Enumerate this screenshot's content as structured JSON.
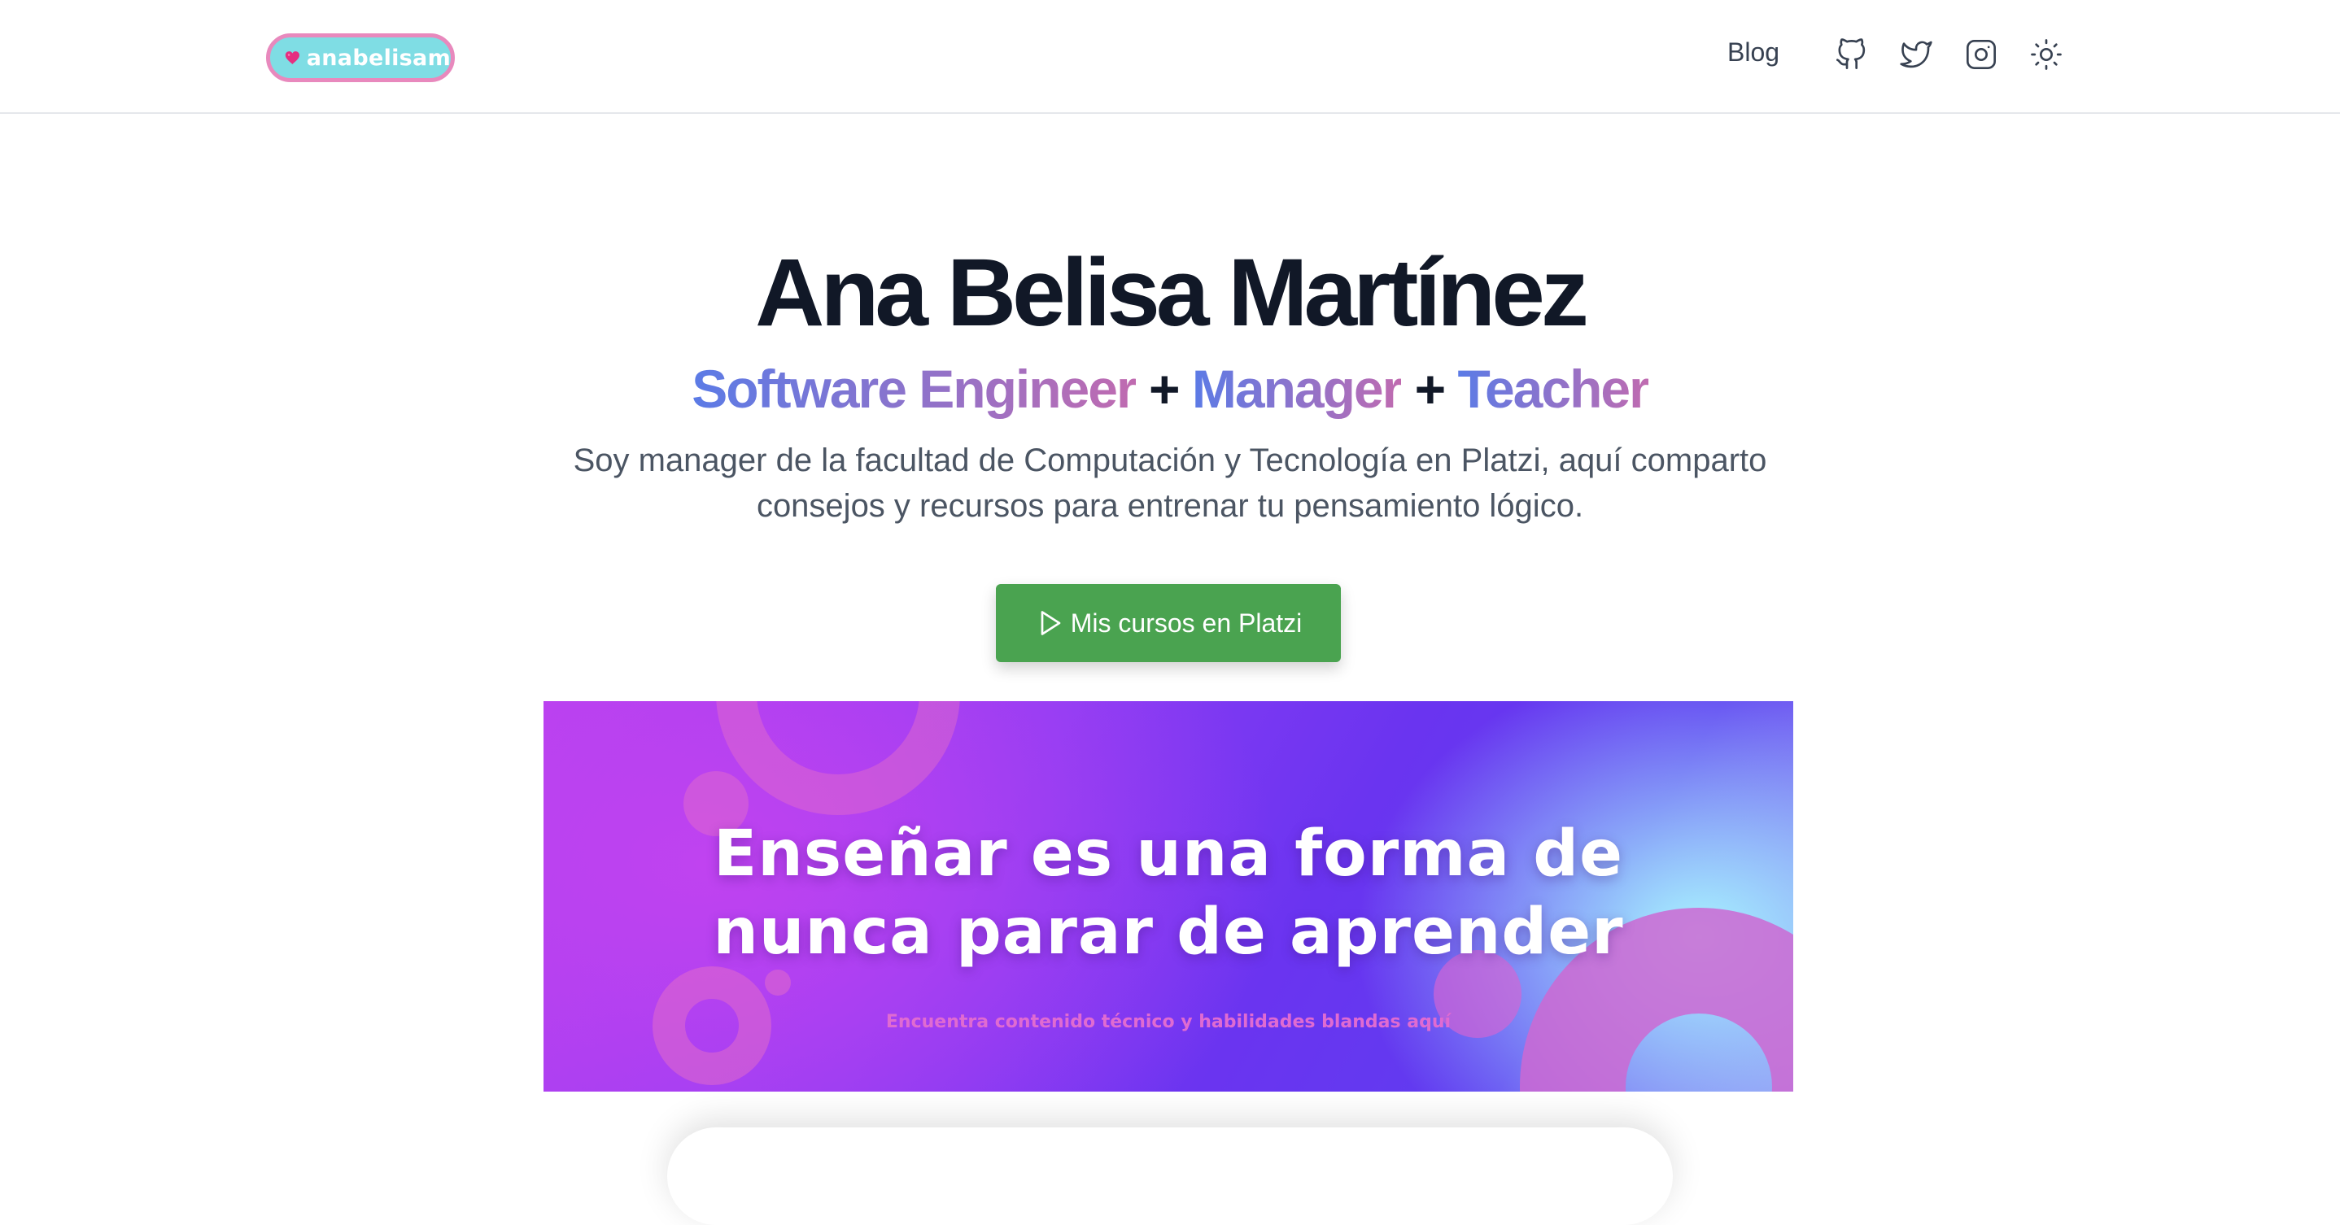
{
  "header": {
    "logo_text": "anabelisam",
    "nav_blog": "Blog",
    "icons": [
      "github-icon",
      "twitter-icon",
      "instagram-icon",
      "sun-icon"
    ]
  },
  "hero": {
    "name": "Ana Belisa Martínez",
    "roles": [
      "Software Engineer",
      "Manager",
      "Teacher"
    ],
    "plus": "+",
    "description_line1": "Soy manager de la facultad de Computación y Tecnología en Platzi, aquí comparto",
    "description_line2": "consejos y recursos para entrenar tu pensamiento lógico.",
    "cta_label": "Mis cursos en Platzi"
  },
  "banner": {
    "headline_line1": "Enseñar es una forma de",
    "headline_line2": "nunca parar de aprender",
    "subtext": "Encuentra contenido técnico y habilidades blandas aquí"
  },
  "colors": {
    "text_dark": "#111827",
    "text_muted": "#4b5563",
    "cta_green": "#4aa350",
    "gradient_start": "#5b7be6",
    "gradient_end": "#c06bb0",
    "logo_bg": "#7fdde4",
    "logo_border": "#e889bd",
    "heart": "#e62e80"
  }
}
